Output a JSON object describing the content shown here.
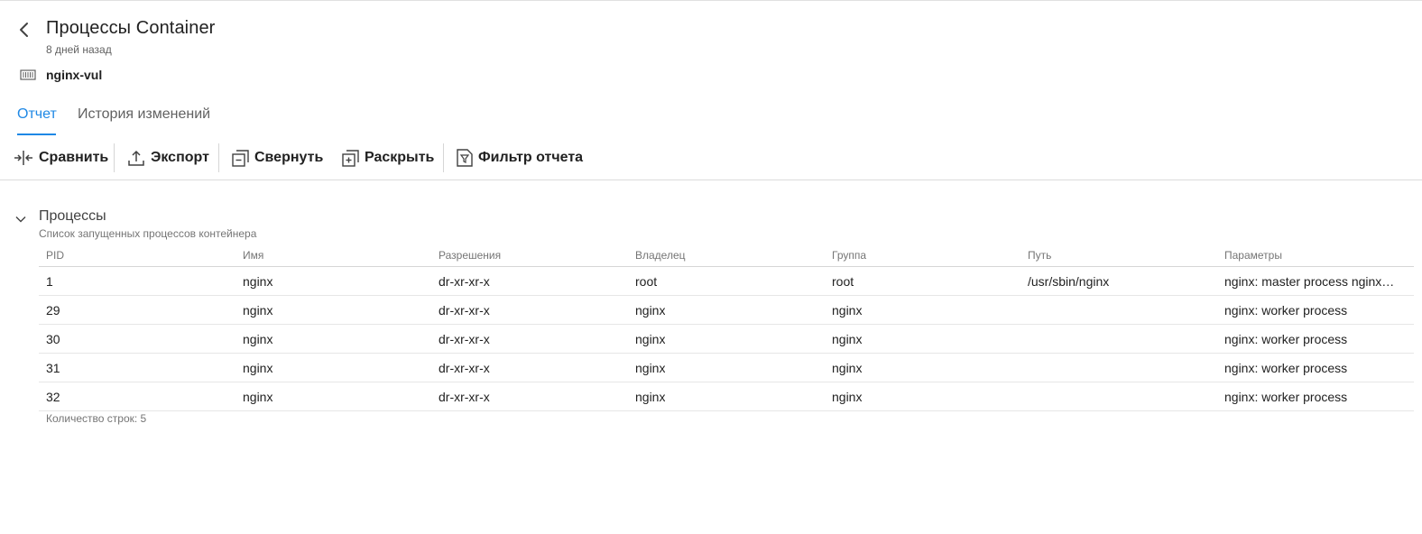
{
  "header": {
    "title": "Процессы Container",
    "subtitle": "8 дней назад",
    "asset_name": "nginx-vul",
    "back_icon": "chevron-left-icon",
    "asset_icon": "container-icon"
  },
  "tabs": [
    {
      "label": "Отчет",
      "active": true
    },
    {
      "label": "История изменений",
      "active": false
    }
  ],
  "toolbar": {
    "compare": "Сравнить",
    "export": "Экспорт",
    "collapse": "Свернуть",
    "expand": "Раскрыть",
    "filter": "Фильтр отчета"
  },
  "section": {
    "title": "Процессы",
    "description": "Список запущенных процессов контейнера"
  },
  "table": {
    "columns": [
      "PID",
      "Имя",
      "Разрешения",
      "Владелец",
      "Группа",
      "Путь",
      "Параметры"
    ],
    "rows": [
      [
        "1",
        "nginx",
        "dr-xr-xr-x",
        "root",
        "root",
        "/usr/sbin/nginx",
        "nginx: master process nginx…"
      ],
      [
        "29",
        "nginx",
        "dr-xr-xr-x",
        "nginx",
        "nginx",
        "",
        "nginx: worker process"
      ],
      [
        "30",
        "nginx",
        "dr-xr-xr-x",
        "nginx",
        "nginx",
        "",
        "nginx: worker process"
      ],
      [
        "31",
        "nginx",
        "dr-xr-xr-x",
        "nginx",
        "nginx",
        "",
        "nginx: worker process"
      ],
      [
        "32",
        "nginx",
        "dr-xr-xr-x",
        "nginx",
        "nginx",
        "",
        "nginx: worker process"
      ]
    ],
    "row_count_label": "Количество строк: 5"
  },
  "colors": {
    "accent": "#1e88e5",
    "text": "#212121",
    "muted": "#757575"
  }
}
